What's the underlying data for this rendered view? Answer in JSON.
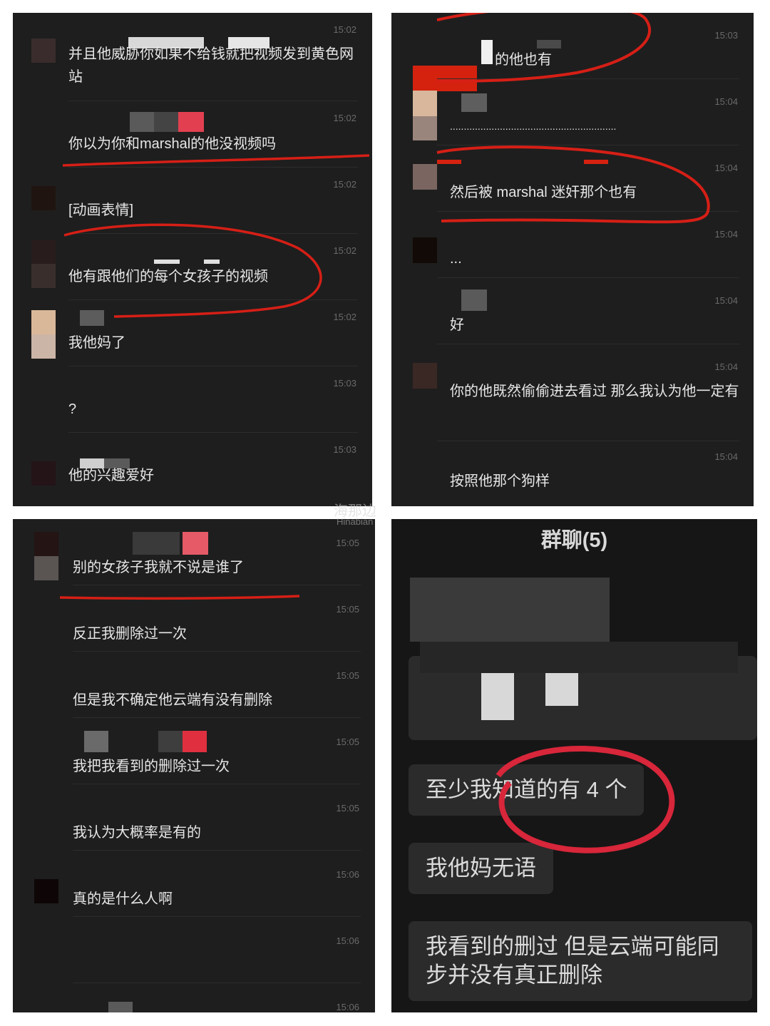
{
  "panels": [
    {
      "messages": [
        {
          "time": "15:02",
          "text": "并且他威胁你如果不给钱就把视频发到黄色网站"
        },
        {
          "time": "15:02",
          "text": "你以为你和marshal的他没视频吗"
        },
        {
          "time": "15:02",
          "text": "[动画表情]"
        },
        {
          "time": "15:02",
          "text": "他有跟他们的每个女孩子的视频"
        },
        {
          "time": "15:02",
          "text": "我他妈了"
        },
        {
          "time": "15:03",
          "text": "?"
        },
        {
          "time": "15:03",
          "text": "他的兴趣爱好"
        }
      ]
    },
    {
      "messages": [
        {
          "time": "15:03",
          "text": "的他也有"
        },
        {
          "time": "15:04",
          "text": "............................................................"
        },
        {
          "time": "15:04",
          "text": "然后被 marshal 迷奸那个也有"
        },
        {
          "time": "15:04",
          "text": "..."
        },
        {
          "time": "15:04",
          "text": "好"
        },
        {
          "time": "15:04",
          "text": "你的他既然偷偷进去看过 那么我认为他一定有"
        },
        {
          "time": "15:04",
          "text": "按照他那个狗样"
        }
      ]
    },
    {
      "messages": [
        {
          "time": "15:05",
          "text": "别的女孩子我就不说是谁了"
        },
        {
          "time": "15:05",
          "text": "反正我删除过一次"
        },
        {
          "time": "15:05",
          "text": "但是我不确定他云端有没有删除"
        },
        {
          "time": "15:05",
          "text": "我把我看到的删除过一次"
        },
        {
          "time": "15:05",
          "text": "我认为大概率是有的"
        },
        {
          "time": "15:06",
          "text": "真的是什么人啊"
        },
        {
          "time": "15:06",
          "text": ""
        },
        {
          "time": "15:06",
          "text": ""
        }
      ]
    }
  ],
  "group_chat": {
    "title": "群聊(5)",
    "bubbles": [
      "至少我知道的有 4 个",
      "我他妈无语",
      "我看到的删过 但是云端可能同步并没有真正删除"
    ]
  },
  "watermark": {
    "main": "海那边",
    "sub": "Hinabian"
  }
}
